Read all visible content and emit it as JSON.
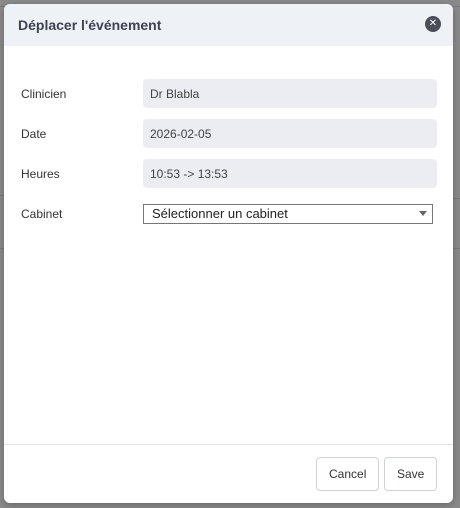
{
  "dialog": {
    "title": "Déplacer l'événement",
    "close_icon": "close-icon"
  },
  "form": {
    "clinician": {
      "label": "Clinicien",
      "value": "Dr Blabla"
    },
    "date": {
      "label": "Date",
      "value": "2026-02-05"
    },
    "hours": {
      "label": "Heures",
      "value": "10:53 -> 13:53"
    },
    "cabinet": {
      "label": "Cabinet",
      "selected": "Sélectionner un cabinet"
    }
  },
  "footer": {
    "cancel_label": "Cancel",
    "save_label": "Save"
  }
}
